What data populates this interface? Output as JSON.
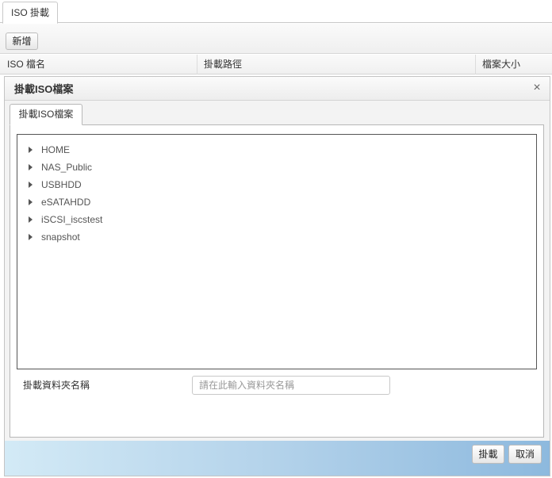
{
  "top_tab": {
    "label": "ISO 掛載"
  },
  "toolbar": {
    "add_label": "新增"
  },
  "table": {
    "columns": [
      "ISO 檔名",
      "掛載路徑",
      "檔案大小"
    ]
  },
  "dialog": {
    "title": "掛載ISO檔案",
    "close_symbol": "×",
    "tab_label": "掛載ISO檔案",
    "tree": [
      {
        "label": "HOME"
      },
      {
        "label": "NAS_Public"
      },
      {
        "label": "USBHDD"
      },
      {
        "label": "eSATAHDD"
      },
      {
        "label": "iSCSI_iscstest"
      },
      {
        "label": "snapshot"
      }
    ],
    "folder_label": "掛載資料夾名稱",
    "folder_placeholder": "請在此輸入資料夾名稱",
    "folder_value": "",
    "mount_label": "掛載",
    "cancel_label": "取消"
  }
}
